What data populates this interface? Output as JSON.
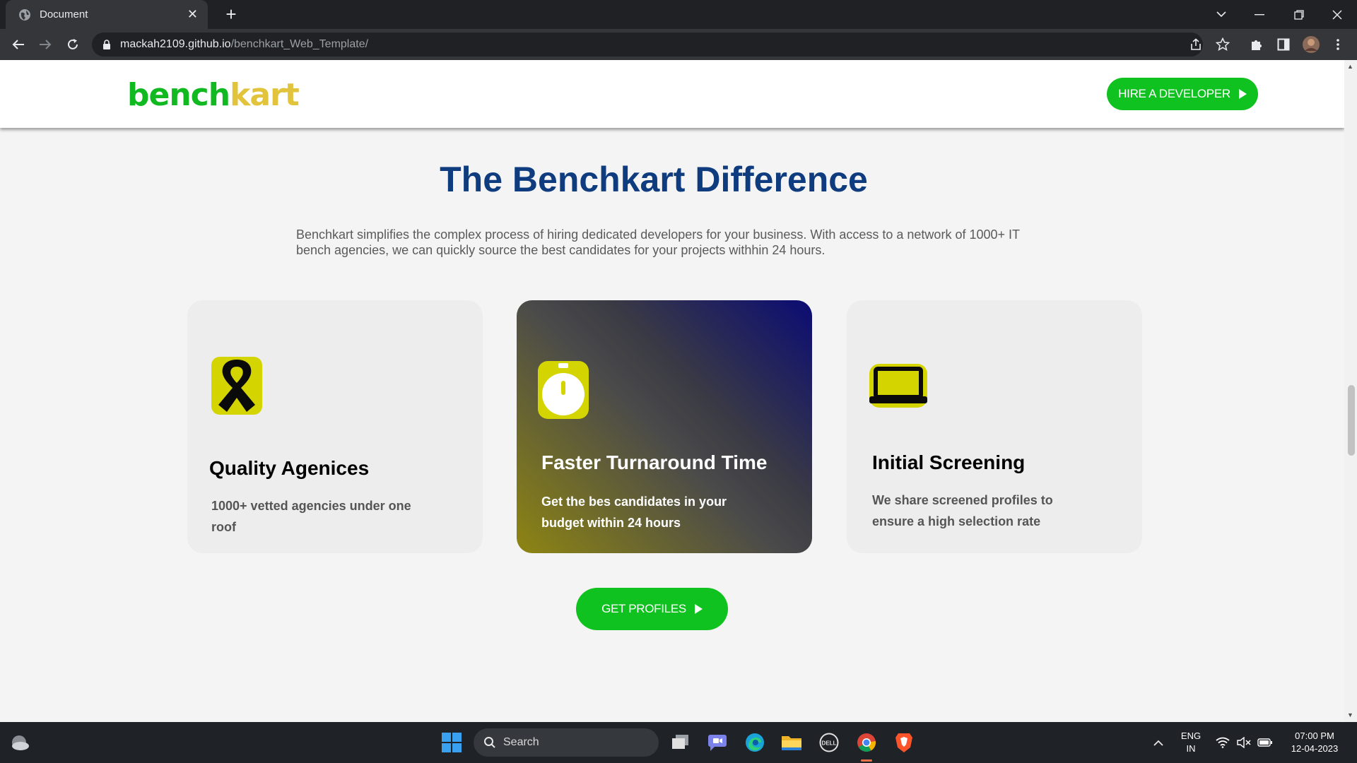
{
  "browser": {
    "tab_title": "Document",
    "tab_close": "✕",
    "new_tab": "+",
    "url_host": "mackah2109.github.io",
    "url_path": "/benchkart_Web_Template/"
  },
  "header": {
    "logo_part1": "bench",
    "logo_part2": "kart",
    "cta_label": "HIRE A DEVELOPER"
  },
  "section": {
    "title": "The Benchkart Difference",
    "description": "Benchkart simplifies the complex process of hiring dedicated developers for your business. With access to a network of 1000+ IT bench agencies, we can quickly source the best candidates for your projects withhin 24 hours."
  },
  "cards": [
    {
      "title": "Quality Agenices",
      "text": "1000+ vetted agencies under one roof",
      "icon": "ribbon-icon"
    },
    {
      "title": "Faster Turnaround Time",
      "text": "Get the bes candidates in your budget within 24 hours",
      "icon": "stopwatch-icon"
    },
    {
      "title": "Initial Screening",
      "text": "We share screened profiles to ensure a high selection rate",
      "icon": "laptop-icon"
    }
  ],
  "cta_bottom": {
    "label": "GET PROFILES"
  },
  "taskbar": {
    "search_label": "Search",
    "lang_line1": "ENG",
    "lang_line2": "IN",
    "time": "07:00 PM",
    "date": "12-04-2023"
  },
  "colors": {
    "brand_green": "#10c21f",
    "brand_yellow": "#e2c33c",
    "title_blue": "#0e3c7e",
    "icon_yellow": "#d4d400"
  }
}
